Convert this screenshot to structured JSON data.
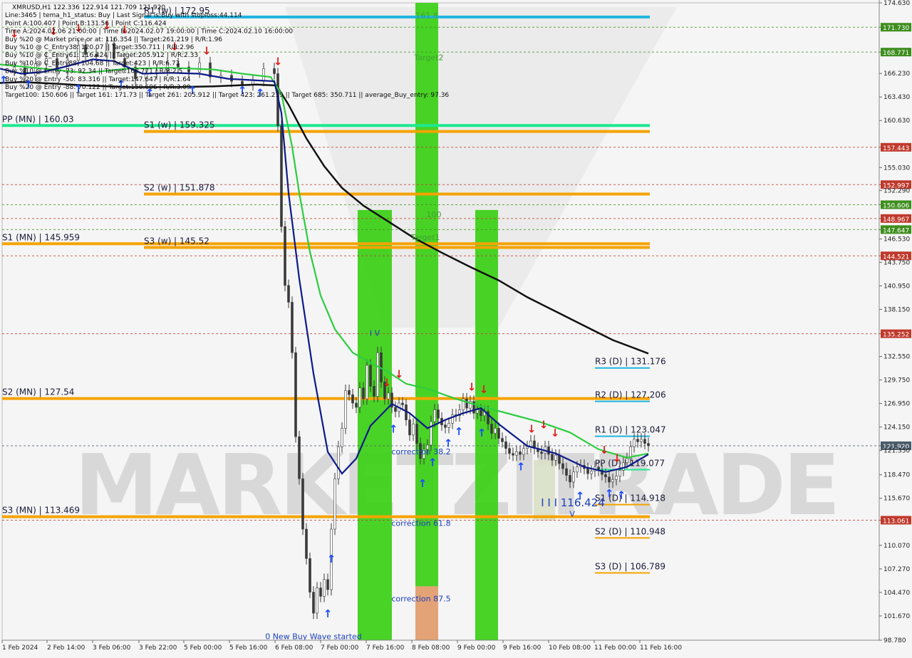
{
  "chart_data": {
    "type": "candlestick",
    "symbol_info": "XMRUSD,H1",
    "watermark": "MARKETZITRADE",
    "ylim": [
      98.78,
      174.63
    ],
    "y_ticks": [
      "174.630",
      "171.730",
      "168.771",
      "166.230",
      "163.430",
      "160.630",
      "157.443",
      "155.030",
      "152.997",
      "152.290",
      "150.606",
      "148.967",
      "147.647",
      "146.530",
      "144.521",
      "143.750",
      "140.950",
      "138.150",
      "135.252",
      "132.550",
      "129.750",
      "126.950",
      "124.150",
      "121.920",
      "121.350",
      "118.470",
      "115.670",
      "113.061",
      "110.070",
      "107.270",
      "104.470",
      "101.670",
      "98.780"
    ],
    "x_ticks": [
      "1 Feb 2024",
      "2 Feb 14:00",
      "3 Feb 06:00",
      "3 Feb 22:00",
      "5 Feb 00:00",
      "5 Feb 16:00",
      "6 Feb 08:00",
      "7 Feb 00:00",
      "7 Feb 16:00",
      "8 Feb 08:00",
      "9 Feb 00:00",
      "9 Feb 16:00",
      "10 Feb 08:00",
      "11 Feb 00:00",
      "11 Feb 16:00"
    ],
    "current_price": 121.92,
    "price_labels": [
      {
        "value": 171.73,
        "text": "171.730",
        "color": "#3e8e1e"
      },
      {
        "value": 168.771,
        "text": "168.771",
        "color": "#3e8e1e"
      },
      {
        "value": 157.443,
        "text": "157.443",
        "color": "#c0392b"
      },
      {
        "value": 152.997,
        "text": "152.997",
        "color": "#c0392b"
      },
      {
        "value": 150.606,
        "text": "150.606",
        "color": "#3e8e1e"
      },
      {
        "value": 148.967,
        "text": "148.967",
        "color": "#c0392b"
      },
      {
        "value": 147.647,
        "text": "147.647",
        "color": "#3e8e1e"
      },
      {
        "value": 144.521,
        "text": "144.521",
        "color": "#c0392b"
      },
      {
        "value": 135.252,
        "text": "135.252",
        "color": "#c0392b"
      },
      {
        "value": 121.92,
        "text": "121.920",
        "color": "#4a5a6a"
      },
      {
        "value": 113.061,
        "text": "113.061",
        "color": "#c0392b"
      }
    ],
    "info_lines": [
      "XMRUSD,H1  122.336 122.914 121.709 121.920",
      "Line:3465 | tema_h1_status: Buy | Last Signal is:Buy with stoploss:44.114",
      "Point A:100.407 | Point B:131.56 | Point C:116.424",
      "Time A:2024.02.06 21:00:00 | Time B:2024.02.07 19:00:00 | Time C:2024.02.10 16:00:00",
      "Buy %20 @ Market price or at: 116.354 || Target:261.219 | R/R:1.96",
      "Buy %10 @ C_Entry38: 120.07 || Target:350.711 | R/R:2.96",
      "Buy %10 @ C_Entry61: 116.424 || Target:205.912 | R/R:2.33",
      "Buy %10 @ C_Entry88: 104.68 || Target:423 | R/R:6.73",
      "Buy %10 @ Entry -23: 92.34 || Target:168.771 | R/R:2.5",
      "Buy %20 @ Entry -50: 83.316 || Target:147.647 | R/R:1.64",
      "Buy %20 @ Entry -88: 70.122 || Target:150.606 | R/R:3.09",
      "Target100: 150.606 || Target 161: 171.73 || Target 261: 205.912 || Target 423: 261.219 || Target 685: 350.711 || average_Buy_entry: 97.36"
    ],
    "levels": [
      {
        "label": "R1 (w) | 172.95",
        "value": 172.95,
        "color": "#1fb5e0"
      },
      {
        "label": "PP (MN) | 160.03",
        "value": 160.03,
        "color": "#1de88e"
      },
      {
        "label": "S1 (w) | 159.325",
        "value": 159.325,
        "color": "#f5a300"
      },
      {
        "label": "S2 (w) | 151.878",
        "value": 151.878,
        "color": "#f5a300"
      },
      {
        "label": "S1 (MN) | 145.959",
        "value": 145.959,
        "color": "#f5a300"
      },
      {
        "label": "S3 (w) | 145.52",
        "value": 145.52,
        "color": "#f5a300"
      },
      {
        "label": "S2 (MN) | 127.54",
        "value": 127.54,
        "color": "#f5a300"
      },
      {
        "label": "S3 (MN) | 113.469",
        "value": 113.469,
        "color": "#f5a300"
      },
      {
        "label": "R3 (D) | 131.176",
        "value": 131.176,
        "color": "#1fb5e0"
      },
      {
        "label": "R2 (D) | 127.206",
        "value": 127.206,
        "color": "#1fb5e0"
      },
      {
        "label": "R1 (D) | 123.047",
        "value": 123.047,
        "color": "#1fb5e0"
      },
      {
        "label": "PP (D) | 119.077",
        "value": 119.077,
        "color": "#1de88e"
      },
      {
        "label": "S1 (D) | 114.918",
        "value": 114.918,
        "color": "#f5a300"
      },
      {
        "label": "S2 (D) | 110.948",
        "value": 110.948,
        "color": "#f5a300"
      },
      {
        "label": "S3 (D) | 106.789",
        "value": 106.789,
        "color": "#f5a300"
      }
    ],
    "annotations": [
      "161.8",
      "Target2",
      "100",
      "Target1",
      "correction 38.2",
      "correction 61.8",
      "correction 87.5",
      "0 New Buy Wave started",
      "I I I 116.424",
      "V",
      "I V"
    ],
    "series": [
      {
        "name": "",
        "color": "#111111",
        "values": [
          [
            0,
            165.1
          ],
          [
            30,
            165.2
          ],
          [
            80,
            165.0
          ],
          [
            120,
            164.8
          ],
          [
            180,
            164.6
          ],
          [
            240,
            164.6
          ],
          [
            300,
            164.7
          ],
          [
            360,
            164.9
          ],
          [
            388,
            164.8
          ],
          [
            405,
            162.5
          ],
          [
            430,
            158.5
          ],
          [
            455,
            155.2
          ],
          [
            480,
            152.6
          ],
          [
            510,
            150.5
          ],
          [
            545,
            148.6
          ],
          [
            580,
            146.7
          ],
          [
            620,
            144.9
          ],
          [
            660,
            143.2
          ],
          [
            700,
            141.6
          ],
          [
            740,
            139.6
          ],
          [
            780,
            137.9
          ],
          [
            820,
            136.2
          ],
          [
            860,
            134.5
          ],
          [
            910,
            132.9
          ]
        ]
      },
      {
        "name": "",
        "color": "#2ecc40",
        "values": [
          [
            0,
            167.3
          ],
          [
            60,
            166.8
          ],
          [
            120,
            166.3
          ],
          [
            180,
            166.8
          ],
          [
            240,
            166.9
          ],
          [
            300,
            166.7
          ],
          [
            340,
            166.2
          ],
          [
            380,
            165.8
          ],
          [
            395,
            163.8
          ],
          [
            410,
            157.5
          ],
          [
            420,
            152.0
          ],
          [
            435,
            145.0
          ],
          [
            450,
            139.8
          ],
          [
            470,
            135.8
          ],
          [
            495,
            133.0
          ],
          [
            520,
            131.8
          ],
          [
            545,
            130.7
          ],
          [
            570,
            129.3
          ],
          [
            600,
            128.7
          ],
          [
            640,
            127.5
          ],
          [
            680,
            126.5
          ],
          [
            720,
            125.6
          ],
          [
            760,
            124.7
          ],
          [
            800,
            123.5
          ],
          [
            840,
            121.5
          ],
          [
            880,
            120.5
          ],
          [
            910,
            121.0
          ]
        ]
      },
      {
        "name": "",
        "color": "#0c1a8a",
        "values": [
          [
            0,
            166.8
          ],
          [
            30,
            166.2
          ],
          [
            60,
            166.4
          ],
          [
            90,
            167.0
          ],
          [
            130,
            167.9
          ],
          [
            160,
            167.7
          ],
          [
            200,
            166.2
          ],
          [
            240,
            166.3
          ],
          [
            280,
            166.2
          ],
          [
            320,
            165.6
          ],
          [
            360,
            165.4
          ],
          [
            385,
            165.3
          ],
          [
            395,
            161.5
          ],
          [
            405,
            152.0
          ],
          [
            420,
            141.8
          ],
          [
            440,
            130.5
          ],
          [
            460,
            121.2
          ],
          [
            480,
            118.6
          ],
          [
            500,
            120.4
          ],
          [
            520,
            124.3
          ],
          [
            550,
            126.9
          ],
          [
            575,
            125.8
          ],
          [
            600,
            124.0
          ],
          [
            625,
            125.0
          ],
          [
            650,
            125.8
          ],
          [
            675,
            126.4
          ],
          [
            700,
            124.5
          ],
          [
            740,
            121.9
          ],
          [
            780,
            121.0
          ],
          [
            820,
            119.4
          ],
          [
            850,
            118.8
          ],
          [
            880,
            119.4
          ],
          [
            910,
            120.9
          ]
        ]
      }
    ]
  }
}
